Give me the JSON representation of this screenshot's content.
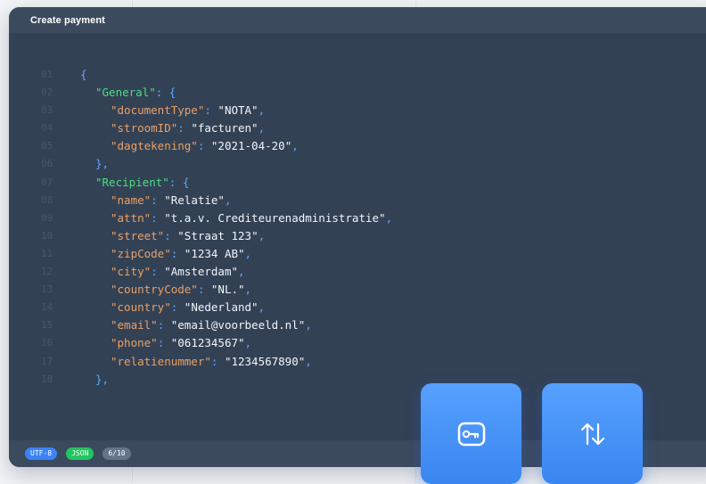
{
  "window": {
    "title": "Create payment"
  },
  "code_lines": [
    {
      "num": "01",
      "indent": 0,
      "parts": [
        {
          "t": "p",
          "v": "{"
        }
      ]
    },
    {
      "num": "02",
      "indent": 1,
      "parts": [
        {
          "t": "kg",
          "v": "\"General\""
        },
        {
          "t": "p",
          "v": ": {"
        }
      ]
    },
    {
      "num": "03",
      "indent": 2,
      "parts": [
        {
          "t": "k",
          "v": "\"documentType\""
        },
        {
          "t": "p",
          "v": ": "
        },
        {
          "t": "s",
          "v": "\"NOTA\""
        },
        {
          "t": "p",
          "v": ","
        }
      ]
    },
    {
      "num": "04",
      "indent": 2,
      "parts": [
        {
          "t": "k",
          "v": "\"stroomID\""
        },
        {
          "t": "p",
          "v": ": "
        },
        {
          "t": "s",
          "v": "\"facturen\""
        },
        {
          "t": "p",
          "v": ","
        }
      ]
    },
    {
      "num": "05",
      "indent": 2,
      "parts": [
        {
          "t": "k",
          "v": "\"dagtekening\""
        },
        {
          "t": "p",
          "v": ": "
        },
        {
          "t": "s",
          "v": "\"2021-04-20\""
        },
        {
          "t": "p",
          "v": ","
        }
      ]
    },
    {
      "num": "06",
      "indent": 1,
      "parts": [
        {
          "t": "p",
          "v": "},"
        }
      ]
    },
    {
      "num": "07",
      "indent": 1,
      "parts": [
        {
          "t": "kg",
          "v": "\"Recipient\""
        },
        {
          "t": "p",
          "v": ": {"
        }
      ]
    },
    {
      "num": "08",
      "indent": 2,
      "parts": [
        {
          "t": "k",
          "v": "\"name\""
        },
        {
          "t": "p",
          "v": ": "
        },
        {
          "t": "s",
          "v": "\"Relatie\""
        },
        {
          "t": "p",
          "v": ","
        }
      ]
    },
    {
      "num": "09",
      "indent": 2,
      "parts": [
        {
          "t": "k",
          "v": "\"attn\""
        },
        {
          "t": "p",
          "v": ": "
        },
        {
          "t": "s",
          "v": "\"t.a.v. Crediteurenadministratie\""
        },
        {
          "t": "p",
          "v": ","
        }
      ]
    },
    {
      "num": "10",
      "indent": 2,
      "parts": [
        {
          "t": "k",
          "v": "\"street\""
        },
        {
          "t": "p",
          "v": ": "
        },
        {
          "t": "s",
          "v": "\"Straat 123\""
        },
        {
          "t": "p",
          "v": ","
        }
      ]
    },
    {
      "num": "11",
      "indent": 2,
      "parts": [
        {
          "t": "k",
          "v": "\"zipCode\""
        },
        {
          "t": "p",
          "v": ": "
        },
        {
          "t": "s",
          "v": "\"1234 AB\""
        },
        {
          "t": "p",
          "v": ","
        }
      ]
    },
    {
      "num": "12",
      "indent": 2,
      "parts": [
        {
          "t": "k",
          "v": "\"city\""
        },
        {
          "t": "p",
          "v": ": "
        },
        {
          "t": "s",
          "v": "\"Amsterdam\""
        },
        {
          "t": "p",
          "v": ","
        }
      ]
    },
    {
      "num": "13",
      "indent": 2,
      "parts": [
        {
          "t": "k",
          "v": "\"countryCode\""
        },
        {
          "t": "p",
          "v": ": "
        },
        {
          "t": "s",
          "v": "\"NL.\""
        },
        {
          "t": "p",
          "v": ","
        }
      ]
    },
    {
      "num": "14",
      "indent": 2,
      "parts": [
        {
          "t": "k",
          "v": "\"country\""
        },
        {
          "t": "p",
          "v": ": "
        },
        {
          "t": "s",
          "v": "\"Nederland\""
        },
        {
          "t": "p",
          "v": ","
        }
      ]
    },
    {
      "num": "15",
      "indent": 2,
      "parts": [
        {
          "t": "k",
          "v": "\"email\""
        },
        {
          "t": "p",
          "v": ": "
        },
        {
          "t": "s",
          "v": "\"email@voorbeeld.nl\""
        },
        {
          "t": "p",
          "v": ","
        }
      ]
    },
    {
      "num": "16",
      "indent": 2,
      "parts": [
        {
          "t": "k",
          "v": "\"phone\""
        },
        {
          "t": "p",
          "v": ": "
        },
        {
          "t": "s",
          "v": "\"061234567\""
        },
        {
          "t": "p",
          "v": ","
        }
      ]
    },
    {
      "num": "17",
      "indent": 2,
      "parts": [
        {
          "t": "k",
          "v": "\"relatienummer\""
        },
        {
          "t": "p",
          "v": ": "
        },
        {
          "t": "s",
          "v": "\"1234567890\""
        },
        {
          "t": "p",
          "v": ","
        }
      ]
    },
    {
      "num": "18",
      "indent": 1,
      "parts": [
        {
          "t": "p",
          "v": "},"
        }
      ]
    }
  ],
  "status": {
    "encoding": "UTF-8",
    "format": "JSON",
    "page": "6/10"
  },
  "actions": {
    "key_icon": "key-icon",
    "swap_icon": "arrows-up-down-icon"
  },
  "colors": {
    "editor_bg": "#334155",
    "key": "#e9a066",
    "section_key": "#4ade80",
    "punctuation": "#60a5fa",
    "string": "#f1f5f9",
    "button": "#4a94f8"
  }
}
